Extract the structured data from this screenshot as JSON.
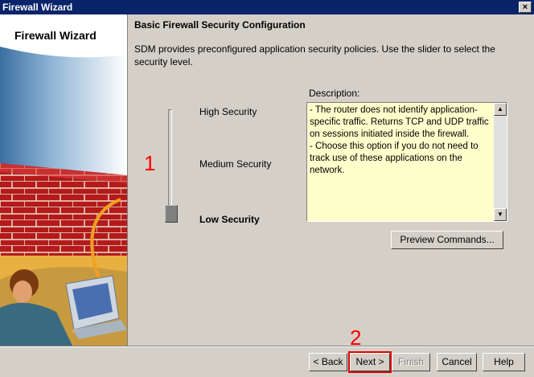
{
  "window": {
    "title": "Firewall Wizard",
    "close_label": "×"
  },
  "left_panel": {
    "title": "Firewall Wizard"
  },
  "header": {
    "title": "Basic Firewall Security Configuration"
  },
  "intro_text": "SDM provides preconfigured application security policies. Use the slider to select the security level.",
  "slider": {
    "levels": [
      "High Security",
      "Medium Security",
      "Low Security"
    ],
    "selected": "Low Security"
  },
  "description": {
    "label": "Description:",
    "text": "- The router does not identify application-specific traffic. Returns TCP and UDP traffic on sessions initiated inside the firewall.\n- Choose this option if you do not need to track use of these applications on the network."
  },
  "buttons": {
    "preview": "Preview Commands...",
    "back": "< Back",
    "next": "Next >",
    "finish": "Finish",
    "cancel": "Cancel",
    "help": "Help"
  },
  "annotations": {
    "one": "1",
    "two": "2"
  },
  "colors": {
    "titlebar": "#0a246a",
    "wall": "#b41a1a",
    "description_bg": "#ffffcc",
    "annotation": "#ff0000"
  }
}
